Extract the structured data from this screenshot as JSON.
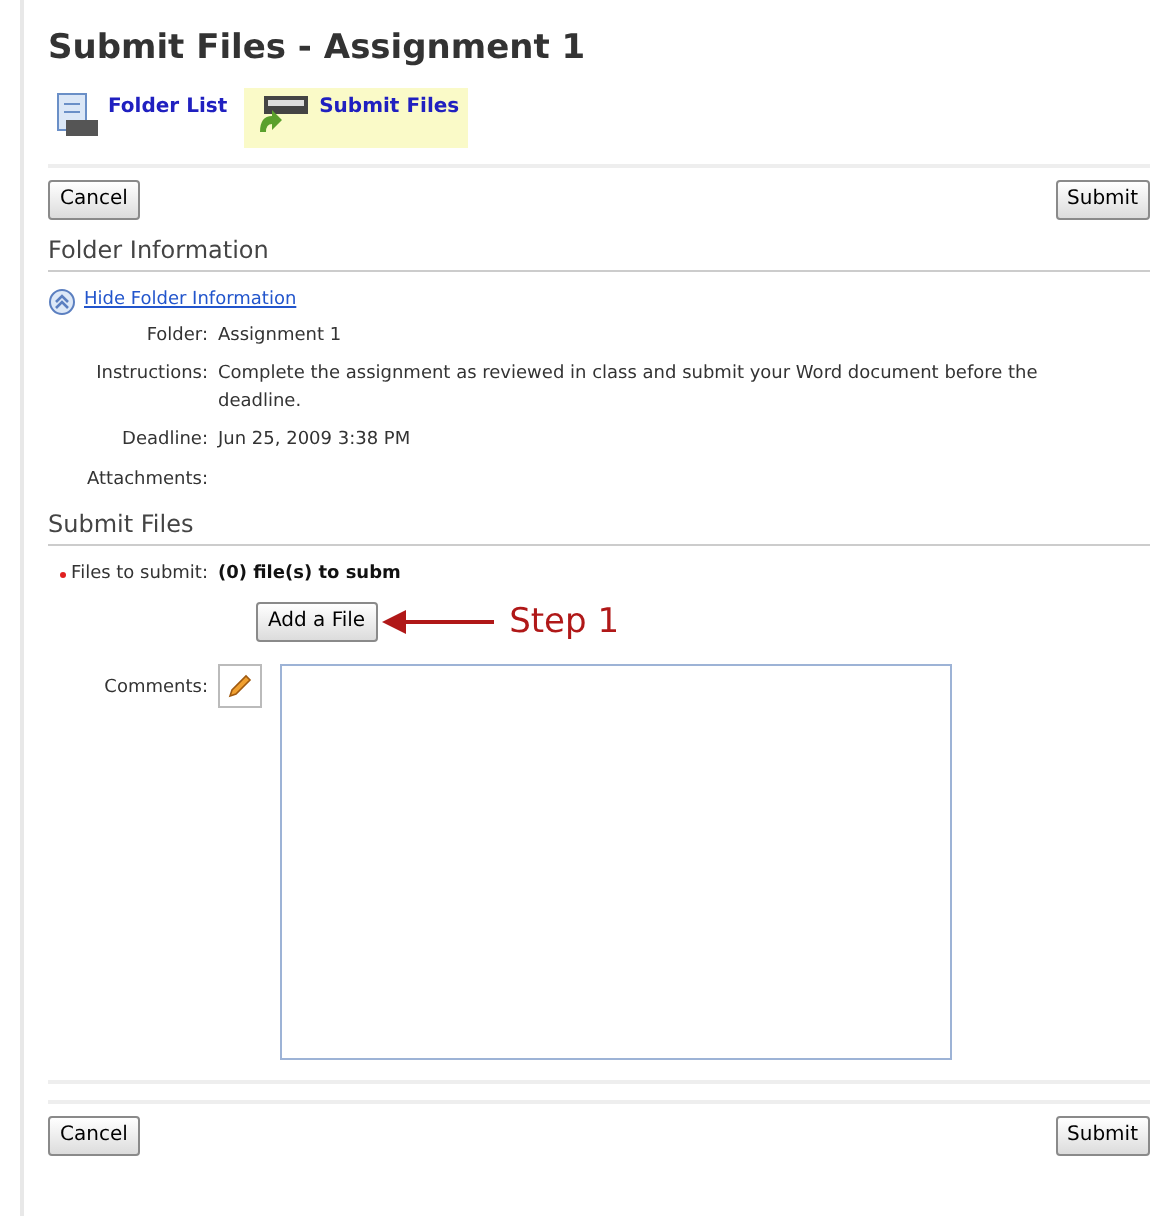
{
  "title": "Submit Files - Assignment 1",
  "nav": [
    {
      "label": "Folder List",
      "selected": false,
      "kind": "list"
    },
    {
      "label": "Submit Files",
      "selected": true,
      "kind": "submit"
    }
  ],
  "top_buttons": {
    "cancel": "Cancel",
    "submit": "Submit"
  },
  "folder_info": {
    "heading": "Folder Information",
    "toggle_link": "Hide Folder Information",
    "fields": [
      {
        "label": "Folder:",
        "value": "Assignment 1"
      },
      {
        "label": "Instructions:",
        "value": "Complete the assignment as reviewed in class and submit your Word document before the deadline."
      },
      {
        "label": "Deadline:",
        "value": "Jun 25, 2009 3:38 PM"
      },
      {
        "label": "Attachments:"
      }
    ]
  },
  "submit_section": {
    "heading": "Submit Files",
    "files_label": "Files to submit:",
    "required": true,
    "files_value": "(0) file(s) to subm",
    "add_button": "Add a File",
    "annotation": "Step 1",
    "comments_label": "Comments:"
  },
  "bottom_buttons": {
    "cancel": "Cancel",
    "submit": "Submit"
  }
}
